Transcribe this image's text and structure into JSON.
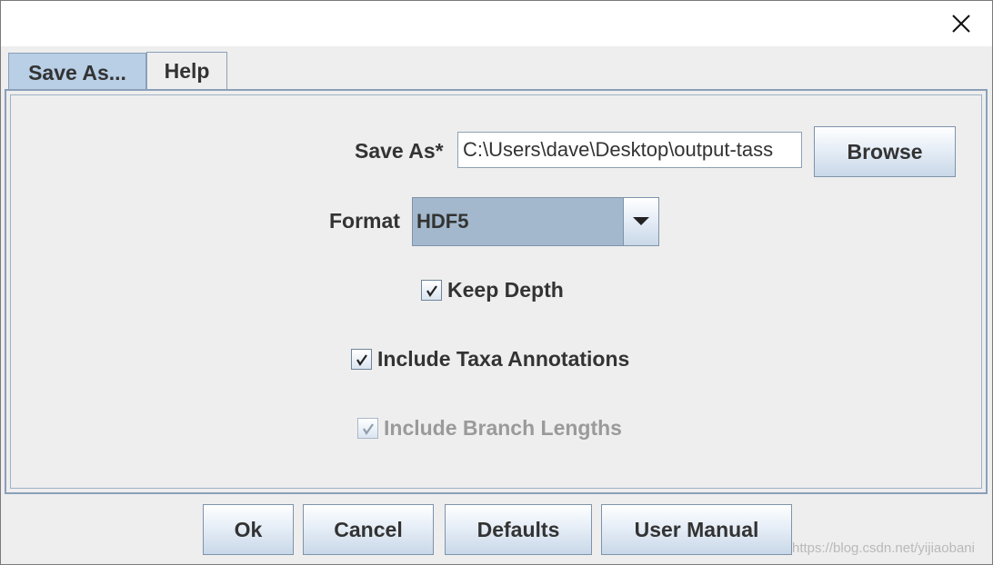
{
  "dialog": {
    "close_icon": "close-icon"
  },
  "tabs": [
    {
      "label": "Save As...",
      "active": true
    },
    {
      "label": "Help",
      "active": false
    }
  ],
  "form": {
    "save_as_label": "Save As*",
    "save_as_value": "C:\\Users\\dave\\Desktop\\output-tass",
    "browse_label": "Browse",
    "format_label": "Format",
    "format_value": "HDF5",
    "keep_depth": {
      "label": "Keep Depth",
      "checked": true,
      "enabled": true
    },
    "include_taxa": {
      "label": "Include Taxa Annotations",
      "checked": true,
      "enabled": true
    },
    "include_branch": {
      "label": "Include Branch Lengths",
      "checked": true,
      "enabled": false
    }
  },
  "buttons": {
    "ok": "Ok",
    "cancel": "Cancel",
    "defaults": "Defaults",
    "user_manual": "User Manual"
  },
  "watermark": "https://blog.csdn.net/yijiaobani",
  "colors": {
    "active_tab": "#b8cfe5",
    "combo_bg": "#a3b8cc",
    "border_accent": "#8aa0b8",
    "disabled_text": "#9a9a9a"
  }
}
